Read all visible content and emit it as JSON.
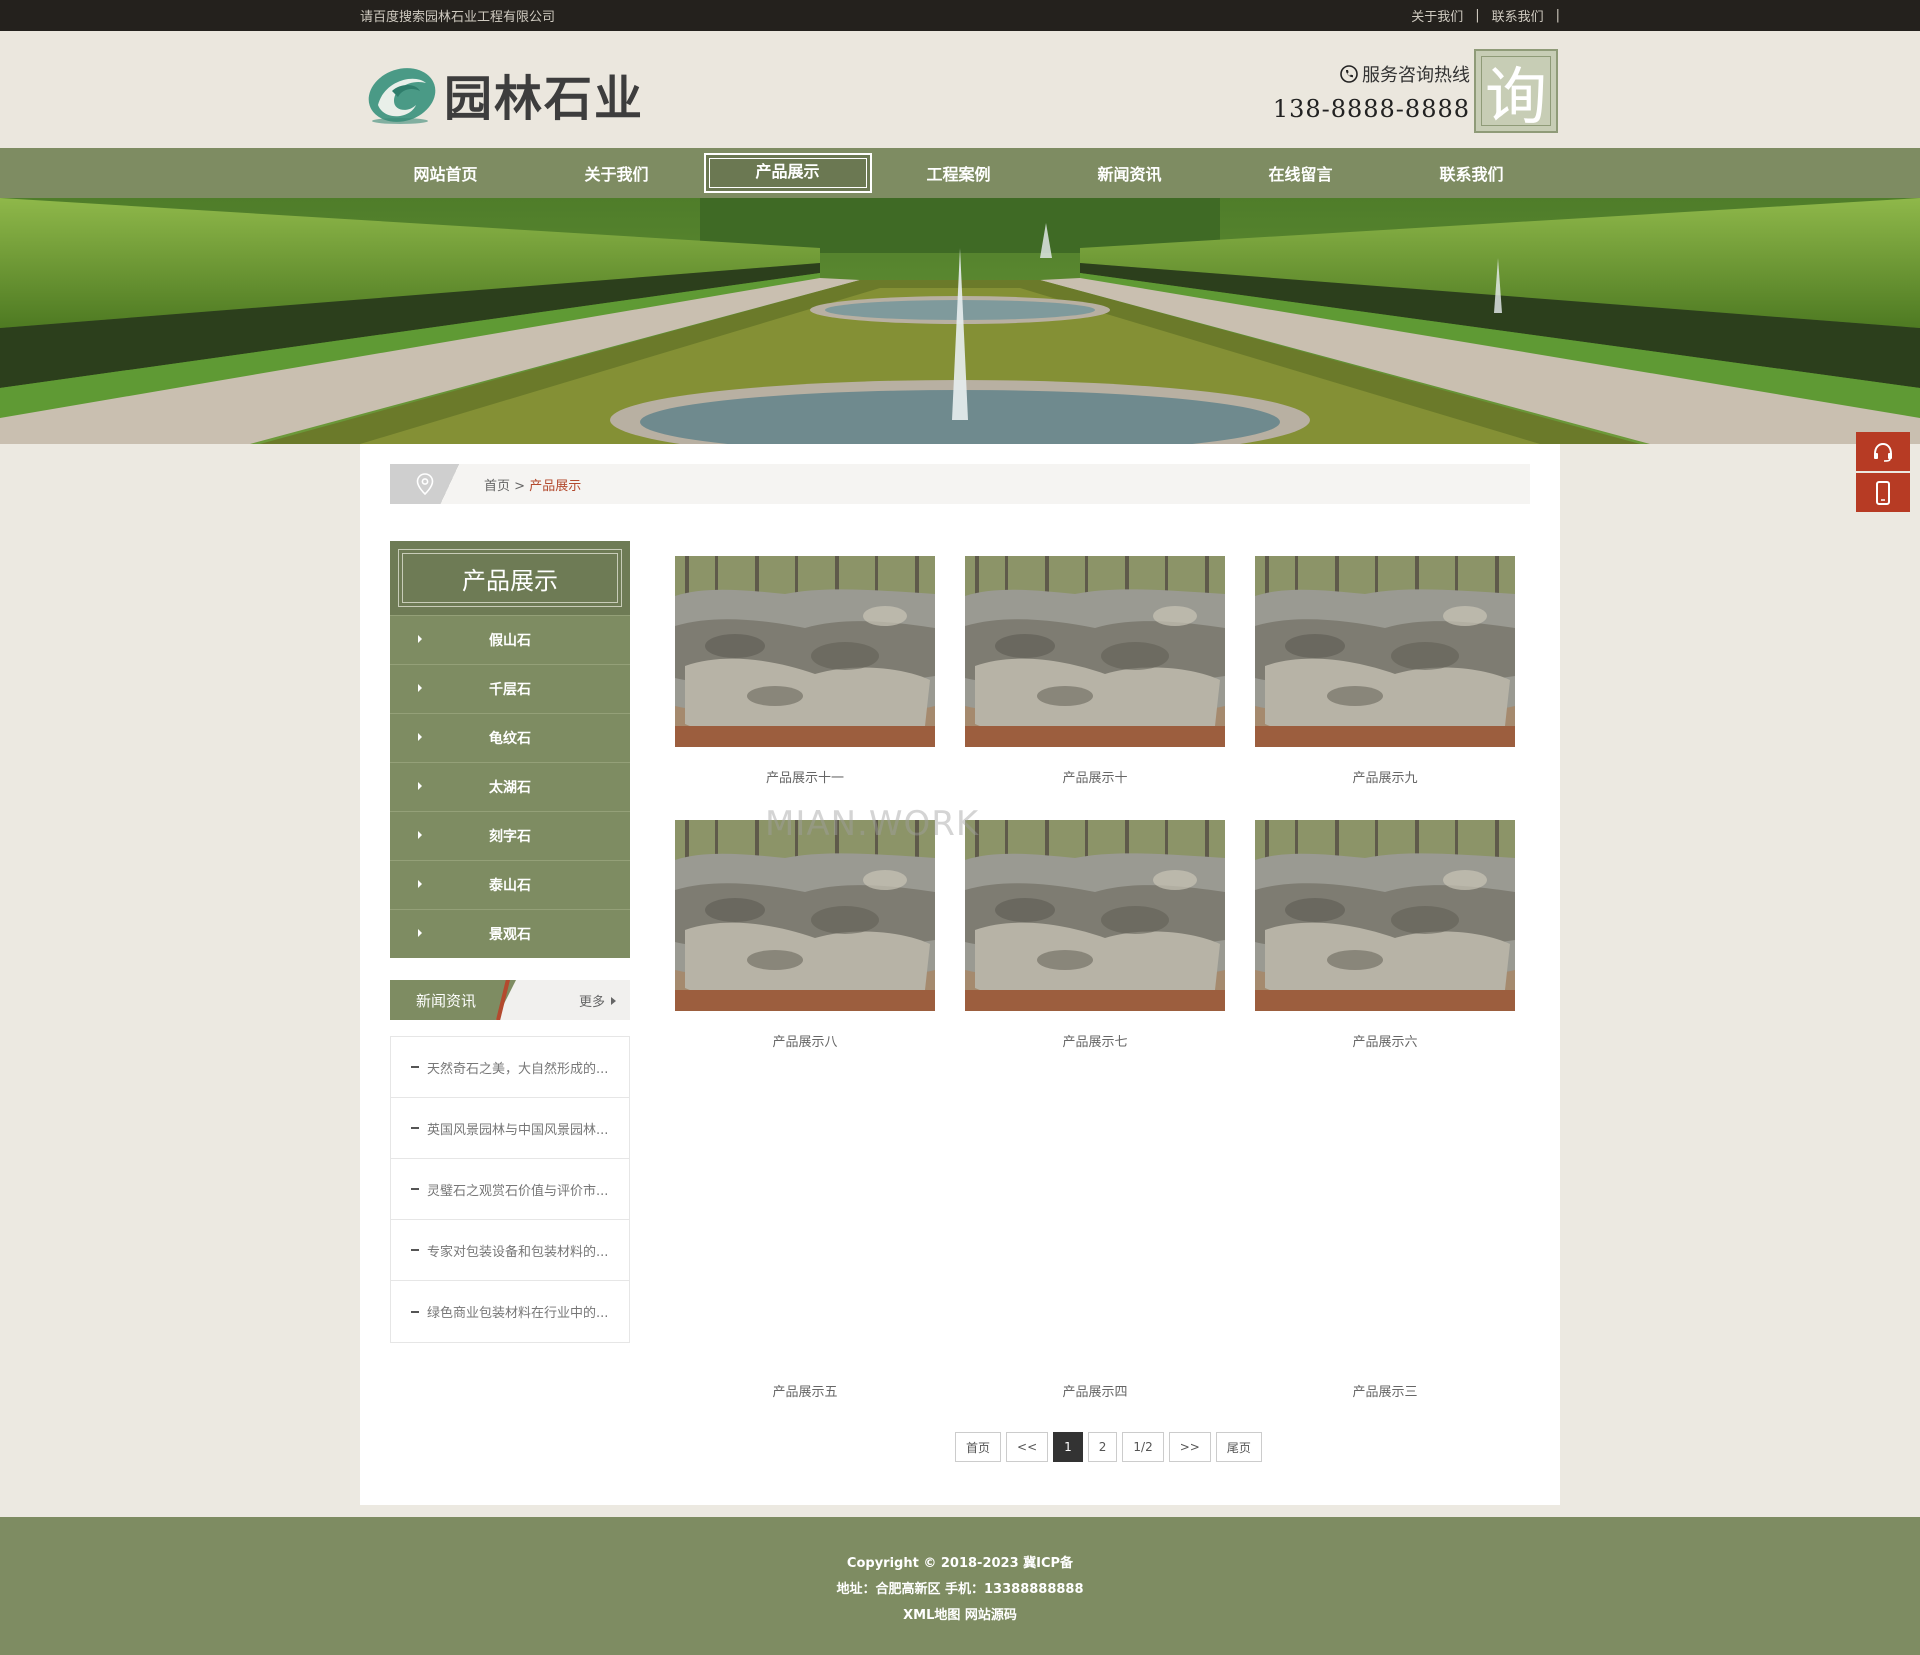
{
  "topbar": {
    "tagline": "请百度搜索园林石业工程有限公司",
    "links": [
      "关于我们",
      "联系我们"
    ]
  },
  "header": {
    "logo_text": "园林石业",
    "hotline_label": "服务咨询热线",
    "hotline_number": "138-8888-8888",
    "consult_char": "询"
  },
  "nav": {
    "items": [
      "网站首页",
      "关于我们",
      "产品展示",
      "工程案例",
      "新闻资讯",
      "在线留言",
      "联系我们"
    ],
    "active": "产品展示"
  },
  "breadcrumb": {
    "home": "首页",
    "separator": " > ",
    "current": "产品展示"
  },
  "sidebar": {
    "title": "产品展示",
    "items": [
      "假山石",
      "千层石",
      "龟纹石",
      "太湖石",
      "刻字石",
      "泰山石",
      "景观石"
    ]
  },
  "news": {
    "title": "新闻资讯",
    "more": "更多",
    "items": [
      "天然奇石之美，大自然形成的...",
      "英国风景园林与中国风景园林...",
      "灵璧石之观赏石价值与评价市...",
      "专家对包装设备和包装材料的...",
      "绿色商业包装材料在行业中的..."
    ]
  },
  "products": [
    {
      "name": "产品展示十一",
      "has_image": true
    },
    {
      "name": "产品展示十",
      "has_image": true
    },
    {
      "name": "产品展示九",
      "has_image": true
    },
    {
      "name": "产品展示八",
      "has_image": true
    },
    {
      "name": "产品展示七",
      "has_image": true
    },
    {
      "name": "产品展示六",
      "has_image": true
    },
    {
      "name": "产品展示五",
      "has_image": false
    },
    {
      "name": "产品展示四",
      "has_image": false
    },
    {
      "name": "产品展示三",
      "has_image": false
    }
  ],
  "watermark": "MIAN.WORK",
  "pager": {
    "first": "首页",
    "prev": "<<",
    "pages": [
      "1",
      "2"
    ],
    "current": "1",
    "info": "1/2",
    "next": ">>",
    "last": "尾页"
  },
  "footer": {
    "line1": "Copyright © 2018-2023    冀ICP备",
    "line2": "地址：合肥高新区 手机：13388888888",
    "line3": "XML地图 网站源码"
  },
  "colors": {
    "olive": "#7e8c62",
    "dark_olive": "#6e7b55",
    "accent_red": "#b73b24",
    "topbar_bg": "#24211d"
  },
  "icons": {
    "breadcrumb": "location-pin-icon",
    "hotline": "phone-icon",
    "float_service": "headset-icon",
    "float_mobile": "mobile-icon"
  }
}
